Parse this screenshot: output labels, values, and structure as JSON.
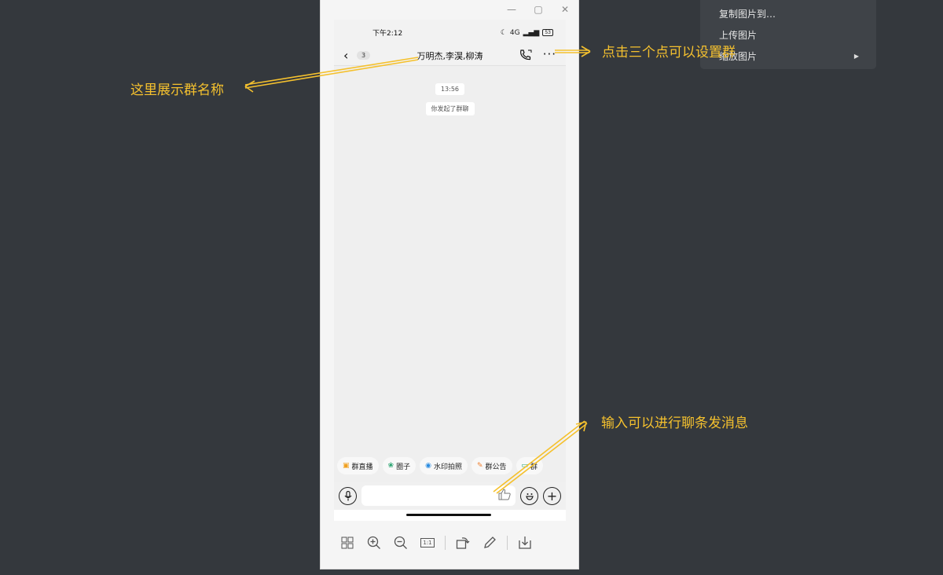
{
  "window_controls": {
    "minimize": "—",
    "maximize": "▢",
    "close": "✕"
  },
  "phone": {
    "status": {
      "time": "下午2:12",
      "network": "4G",
      "battery": "53"
    },
    "nav": {
      "back": "‹",
      "unread": "3",
      "title": "万明杰,李淏,柳涛",
      "more": "···"
    },
    "chat": {
      "timestamp": "13:56",
      "system_message": "你发起了群聊"
    },
    "quick_actions": [
      {
        "icon": "▣",
        "label": "群直播",
        "color": "#f0a020"
      },
      {
        "icon": "❀",
        "label": "圈子",
        "color": "#22a06b"
      },
      {
        "icon": "◉",
        "label": "水印拍照",
        "color": "#2a8ce0"
      },
      {
        "icon": "✎",
        "label": "群公告",
        "color": "#f08030"
      },
      {
        "icon": "▭",
        "label": "群",
        "color": "#22a06b"
      }
    ],
    "input": {
      "voice": "🎙",
      "like": "👍",
      "emoji": "☺",
      "plus": "+"
    }
  },
  "toolbar": {
    "fit": "⊞",
    "zoom_in": "⊕",
    "zoom_out": "⊖",
    "actual_size": "1:1",
    "rotate": "⟳",
    "edit": "✎",
    "save": "⤓"
  },
  "context_menu": [
    {
      "label": "复制图片到…",
      "has_submenu": false
    },
    {
      "label": "上传图片",
      "has_submenu": false
    },
    {
      "label": "缩放图片",
      "has_submenu": true,
      "arrow": "▶"
    }
  ],
  "annotations": {
    "group_name": "这里展示群名称",
    "more_dots": "点击三个点可以设置群",
    "input": "输入可以进行聊条发消息"
  }
}
